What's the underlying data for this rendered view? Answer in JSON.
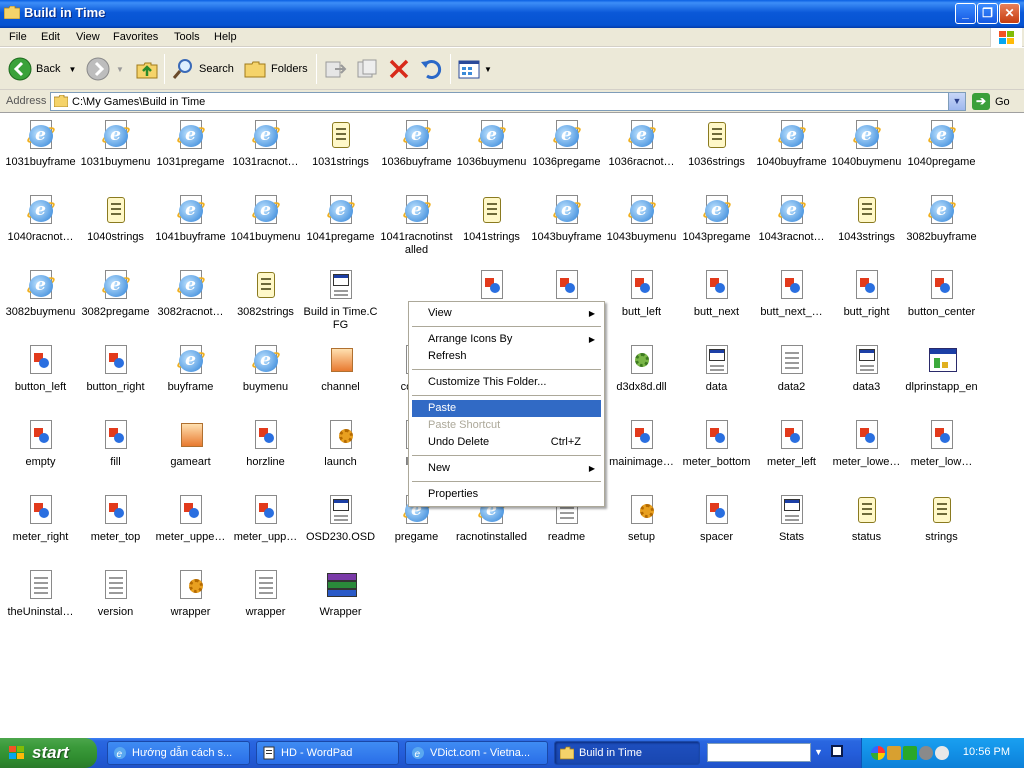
{
  "window": {
    "title": "Build in Time",
    "buttons": {
      "minimize": "_",
      "maximize": "❐",
      "close": "✕"
    }
  },
  "menubar": [
    "File",
    "Edit",
    "View",
    "Favorites",
    "Tools",
    "Help"
  ],
  "toolbar": {
    "back": "Back",
    "search": "Search",
    "folders": "Folders"
  },
  "address": {
    "label": "Address",
    "path": "C:\\My Games\\Build in Time",
    "go": "Go"
  },
  "files": [
    {
      "name": "1031buyframe",
      "type": "ie"
    },
    {
      "name": "1031buymenu",
      "type": "ie"
    },
    {
      "name": "1031pregame",
      "type": "ie"
    },
    {
      "name": "1031racnot…",
      "type": "ie"
    },
    {
      "name": "1031strings",
      "type": "scr"
    },
    {
      "name": "1036buyframe",
      "type": "ie"
    },
    {
      "name": "1036buymenu",
      "type": "ie"
    },
    {
      "name": "1036pregame",
      "type": "ie"
    },
    {
      "name": "1036racnot…",
      "type": "ie"
    },
    {
      "name": "1036strings",
      "type": "scr"
    },
    {
      "name": "1040buyframe",
      "type": "ie"
    },
    {
      "name": "1040buymenu",
      "type": "ie"
    },
    {
      "name": "1040pregame",
      "type": "ie"
    },
    {
      "name": "1040racnot…",
      "type": "ie"
    },
    {
      "name": "1040strings",
      "type": "scr"
    },
    {
      "name": "1041buyframe",
      "type": "ie"
    },
    {
      "name": "1041buymenu",
      "type": "ie"
    },
    {
      "name": "1041pregame",
      "type": "ie"
    },
    {
      "name": "1041racnotinstalled",
      "type": "ie",
      "wrap": true
    },
    {
      "name": "1041strings",
      "type": "scr"
    },
    {
      "name": "1043buyframe",
      "type": "ie"
    },
    {
      "name": "1043buymenu",
      "type": "ie"
    },
    {
      "name": "1043pregame",
      "type": "ie"
    },
    {
      "name": "1043racnot…",
      "type": "ie"
    },
    {
      "name": "1043strings",
      "type": "scr"
    },
    {
      "name": "3082buyframe",
      "type": "ie"
    },
    {
      "name": "3082buymenu",
      "type": "ie"
    },
    {
      "name": "3082pregame",
      "type": "ie"
    },
    {
      "name": "3082racnot…",
      "type": "ie"
    },
    {
      "name": "3082strings",
      "type": "scr"
    },
    {
      "name": "Build in Time.CFG",
      "type": "cfg",
      "wrap": true
    },
    {
      "name": "",
      "type": "none"
    },
    {
      "name": "",
      "type": "img"
    },
    {
      "name": "",
      "type": "img"
    },
    {
      "name": "butt_left",
      "type": "img"
    },
    {
      "name": "butt_next",
      "type": "img"
    },
    {
      "name": "butt_next_…",
      "type": "img"
    },
    {
      "name": "butt_right",
      "type": "img"
    },
    {
      "name": "button_center",
      "type": "img"
    },
    {
      "name": "button_left",
      "type": "img"
    },
    {
      "name": "button_right",
      "type": "img"
    },
    {
      "name": "buyframe",
      "type": "ie"
    },
    {
      "name": "buymenu",
      "type": "ie"
    },
    {
      "name": "channel",
      "type": "ch"
    },
    {
      "name": "cont…",
      "type": "img"
    },
    {
      "name": "",
      "type": "none"
    },
    {
      "name": "",
      "type": "none"
    },
    {
      "name": "d3dx8d.dll",
      "type": "dll"
    },
    {
      "name": "data",
      "type": "cfg"
    },
    {
      "name": "data2",
      "type": "txt"
    },
    {
      "name": "data3",
      "type": "cfg"
    },
    {
      "name": "dlprinstapp_en",
      "type": "exe"
    },
    {
      "name": "empty",
      "type": "img"
    },
    {
      "name": "fill",
      "type": "img"
    },
    {
      "name": "gameart",
      "type": "ch"
    },
    {
      "name": "horzline",
      "type": "img"
    },
    {
      "name": "launch",
      "type": "gear"
    },
    {
      "name": "lic…",
      "type": "img"
    },
    {
      "name": "",
      "type": "none"
    },
    {
      "name": "mainimage_…",
      "type": "img"
    },
    {
      "name": "mainimage…",
      "type": "img"
    },
    {
      "name": "meter_bottom",
      "type": "img"
    },
    {
      "name": "meter_left",
      "type": "img"
    },
    {
      "name": "meter_lowe…",
      "type": "img"
    },
    {
      "name": "meter_low…",
      "type": "img"
    },
    {
      "name": "meter_right",
      "type": "img"
    },
    {
      "name": "meter_top",
      "type": "img"
    },
    {
      "name": "meter_uppe…",
      "type": "img"
    },
    {
      "name": "meter_upp…",
      "type": "img"
    },
    {
      "name": "OSD230.OSD",
      "type": "cfg"
    },
    {
      "name": "pregame",
      "type": "ie"
    },
    {
      "name": "racnotinstalled",
      "type": "ie"
    },
    {
      "name": "readme",
      "type": "txt"
    },
    {
      "name": "setup",
      "type": "gear"
    },
    {
      "name": "spacer",
      "type": "img"
    },
    {
      "name": "Stats",
      "type": "cfg"
    },
    {
      "name": "status",
      "type": "scr"
    },
    {
      "name": "strings",
      "type": "scr"
    },
    {
      "name": "theUninstal…",
      "type": "txt"
    },
    {
      "name": "version",
      "type": "txt"
    },
    {
      "name": "wrapper",
      "type": "gear"
    },
    {
      "name": "wrapper",
      "type": "txt"
    },
    {
      "name": "Wrapper",
      "type": "rar"
    }
  ],
  "context_menu": {
    "items": [
      {
        "label": "View",
        "submenu": true
      },
      {
        "sep": true
      },
      {
        "label": "Arrange Icons By",
        "submenu": true
      },
      {
        "label": "Refresh"
      },
      {
        "sep": true
      },
      {
        "label": "Customize This Folder..."
      },
      {
        "sep": true
      },
      {
        "label": "Paste",
        "selected": true
      },
      {
        "label": "Paste Shortcut",
        "disabled": true
      },
      {
        "label": "Undo Delete",
        "shortcut": "Ctrl+Z"
      },
      {
        "sep": true
      },
      {
        "label": "New",
        "submenu": true
      },
      {
        "sep": true
      },
      {
        "label": "Properties"
      }
    ]
  },
  "taskbar": {
    "start": "start",
    "tasks": [
      {
        "label": "Hướng dẫn cách s...",
        "active": false
      },
      {
        "label": "HD - WordPad",
        "active": false
      },
      {
        "label": "VDict.com - Vietna...",
        "active": false
      },
      {
        "label": "Build in Time",
        "active": true
      }
    ],
    "clock": "10:56 PM"
  },
  "colors": {
    "title_blue": "#0a58d8",
    "selection": "#316ac5",
    "taskbar": "#245edb",
    "start_green": "#3a9a3a",
    "tray": "#1290e6"
  }
}
